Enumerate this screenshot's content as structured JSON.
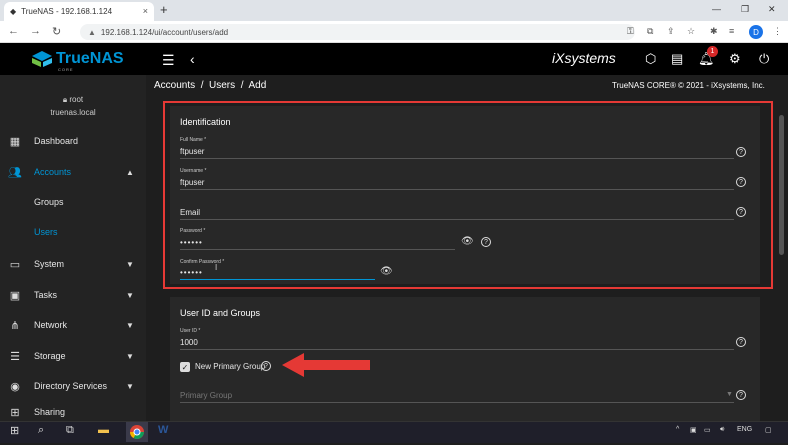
{
  "browser": {
    "tab_title": "TrueNAS - 192.168.1.124",
    "tab_close": "×",
    "new_tab": "+",
    "url": "192.168.1.124/ui/account/users/add",
    "profile_initial": "D"
  },
  "app": {
    "brand": "TrueNAS",
    "brand_sub": "CORE",
    "vendor": "iXsystems",
    "notification_count": "1",
    "breadcrumb": "Accounts  /  Users  /  Add",
    "copyright": "TrueNAS CORE® © 2021 - iXsystems, Inc."
  },
  "sidebar": {
    "user": "root",
    "host": "truenas.local",
    "items": [
      {
        "label": "Dashboard"
      },
      {
        "label": "Accounts"
      },
      {
        "label": "Groups"
      },
      {
        "label": "Users"
      },
      {
        "label": "System"
      },
      {
        "label": "Tasks"
      },
      {
        "label": "Network"
      },
      {
        "label": "Storage"
      },
      {
        "label": "Directory Services"
      },
      {
        "label": "Sharing"
      }
    ]
  },
  "identification": {
    "title": "Identification",
    "full_name_label": "Full Name *",
    "full_name_value": "ftpuser",
    "username_label": "Username *",
    "username_value": "ftpuser",
    "email_label": "Email",
    "password_label": "Password *",
    "password_value": "••••••",
    "confirm_label": "Confirm Password *",
    "confirm_value": "••••••"
  },
  "userid_groups": {
    "title": "User ID and Groups",
    "userid_label": "User ID *",
    "userid_value": "1000",
    "new_primary_group_label": "New Primary Group",
    "new_primary_group_checked": true,
    "primary_group_label": "Primary Group"
  },
  "taskbar": {
    "language": "ENG"
  },
  "colors": {
    "accent": "#0095d5",
    "highlight_box": "#e53935",
    "arrow": "#e53935"
  }
}
